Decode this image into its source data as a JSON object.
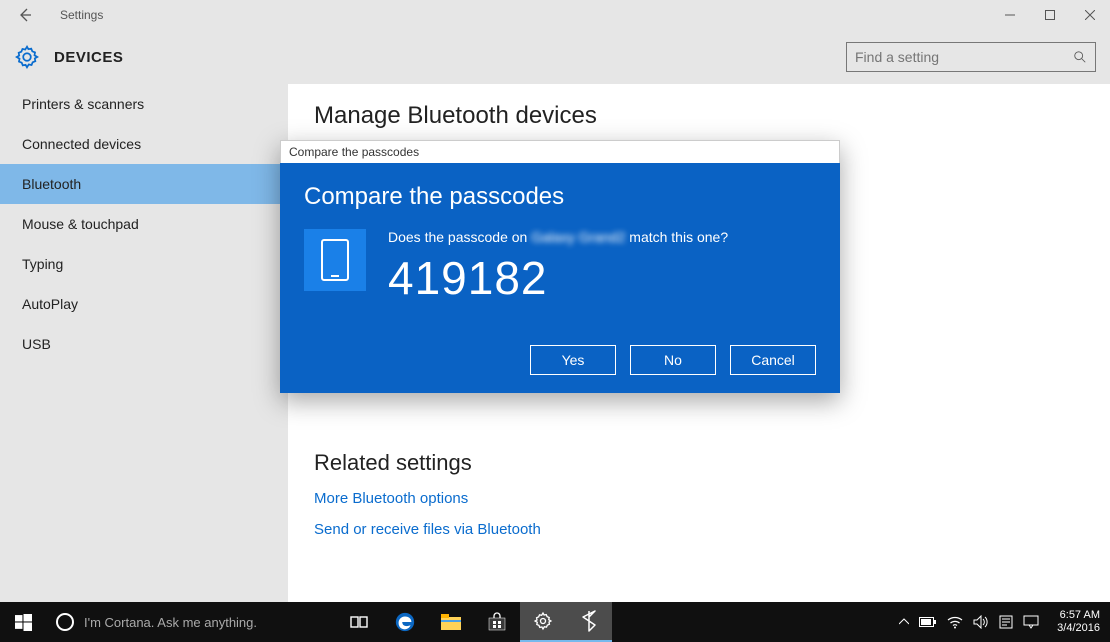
{
  "window": {
    "app_name": "Settings"
  },
  "header": {
    "section": "DEVICES",
    "search_placeholder": "Find a setting"
  },
  "sidebar": {
    "items": [
      {
        "label": "Printers & scanners",
        "active": false
      },
      {
        "label": "Connected devices",
        "active": false
      },
      {
        "label": "Bluetooth",
        "active": true
      },
      {
        "label": "Mouse & touchpad",
        "active": false
      },
      {
        "label": "Typing",
        "active": false
      },
      {
        "label": "AutoPlay",
        "active": false
      },
      {
        "label": "USB",
        "active": false
      }
    ]
  },
  "main": {
    "heading": "Manage Bluetooth devices",
    "related_heading": "Related settings",
    "links": [
      "More Bluetooth options",
      "Send or receive files via Bluetooth"
    ]
  },
  "dialog": {
    "title": "Compare the passcodes",
    "heading": "Compare the passcodes",
    "message_pre": "Does the passcode on ",
    "device": "Galaxy Grand2",
    "message_post": " match this one?",
    "passcode": "419182",
    "buttons": {
      "yes": "Yes",
      "no": "No",
      "cancel": "Cancel"
    }
  },
  "taskbar": {
    "cortana_placeholder": "I'm Cortana. Ask me anything.",
    "time": "6:57 AM",
    "date": "3/4/2016"
  }
}
